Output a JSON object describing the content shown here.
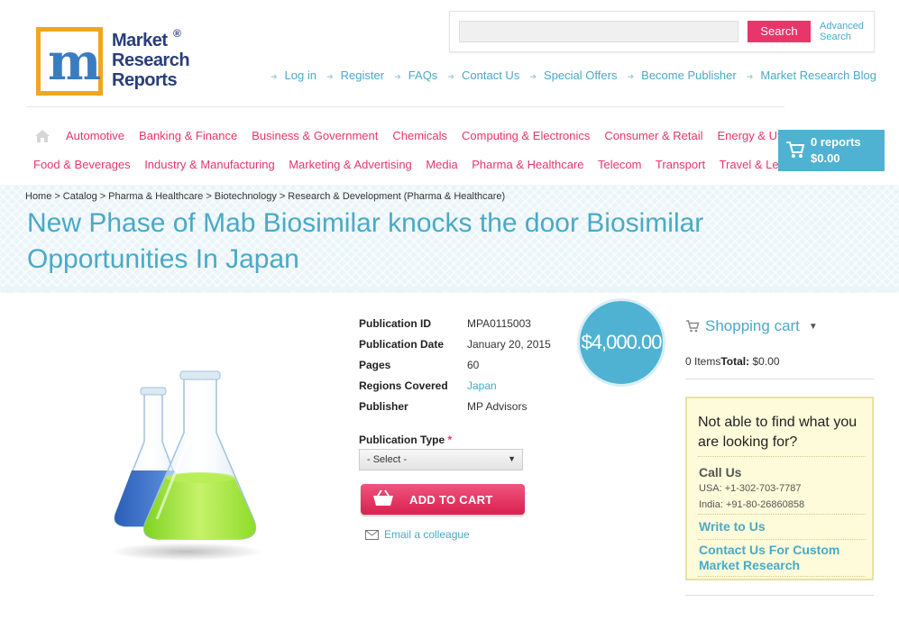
{
  "logo": {
    "line1": "Market",
    "line2": "Research",
    "line3": "Reports",
    "reg": "®"
  },
  "search": {
    "placeholder": "",
    "button": "Search",
    "advanced": "Advanced Search"
  },
  "toplinks": [
    "Log in",
    "Register",
    "FAQs",
    "Contact Us",
    "Special Offers",
    "Become Publisher",
    "Market Research Blog"
  ],
  "categories_row1": [
    "Automotive",
    "Banking & Finance",
    "Business & Government",
    "Chemicals",
    "Computing & Electronics",
    "Consumer & Retail",
    "Energy & Utilities"
  ],
  "categories_row2": [
    "Food & Beverages",
    "Industry & Manufacturing",
    "Marketing & Advertising",
    "Media",
    "Pharma & Healthcare",
    "Telecom",
    "Transport",
    "Travel & Leisure"
  ],
  "cart": {
    "count": "0 reports",
    "total": "$0.00"
  },
  "breadcrumb": [
    "Home",
    "Catalog",
    "Pharma & Healthcare",
    "Biotechnology",
    "Research & Development (Pharma & Healthcare)"
  ],
  "title": "New Phase of Mab Biosimilar knocks the door Biosimilar Opportunities In Japan",
  "details": [
    {
      "k": "Publication ID",
      "v": "MPA0115003"
    },
    {
      "k": "Publication Date",
      "v": "January 20, 2015"
    },
    {
      "k": "Pages",
      "v": "60"
    },
    {
      "k": "Regions Covered",
      "v": "Japan"
    },
    {
      "k": "Publisher",
      "v": "MP Advisors"
    }
  ],
  "publication_type": {
    "label": "Publication Type",
    "required": "*",
    "selected": "- Select -"
  },
  "add_to_cart": "ADD TO CART",
  "email_colleague": "Email a colleague",
  "price": "$4,000.00",
  "shopping_cart": {
    "title": "Shopping cart",
    "items": "0 Items",
    "total_label": "Total:",
    "total_value": "$0.00"
  },
  "help": {
    "title": "Not able to find what you are looking for?",
    "call_us": "Call Us",
    "usa": "USA: +1-302-703-7787",
    "india": "India: +91-80-26860858",
    "write": "Write to Us",
    "custom": "Contact Us For Custom Market Research"
  },
  "colors": {
    "accent_blue": "#4aa9c7",
    "accent_pink": "#e8366b",
    "logo_orange": "#f2a51f"
  }
}
